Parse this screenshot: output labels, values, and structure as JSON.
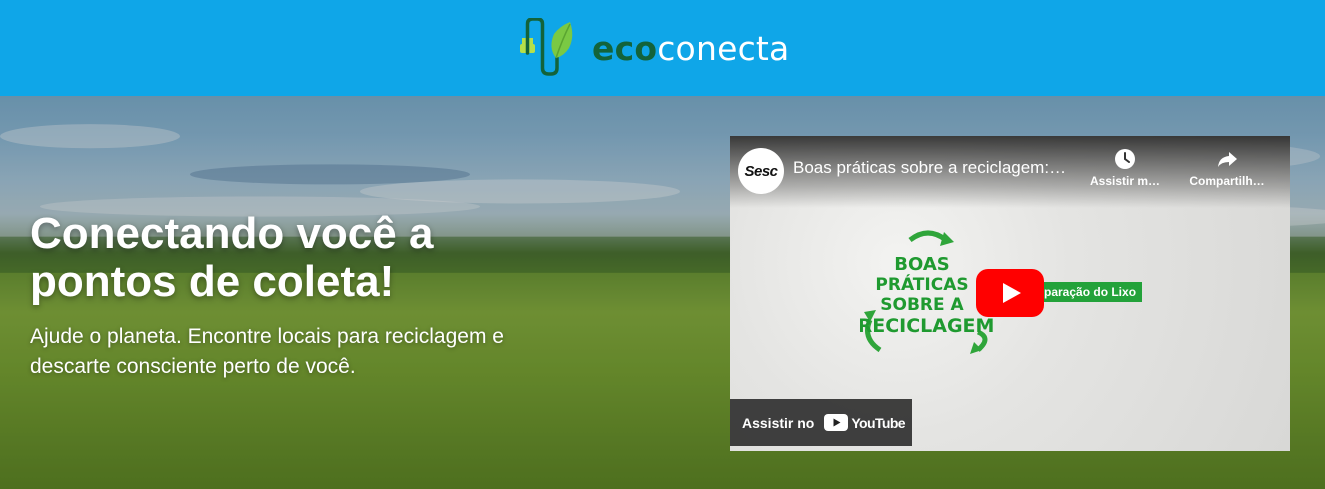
{
  "header": {
    "logo": {
      "part1": "eco",
      "part2": "conecta",
      "icon": "plug-leaf-icon"
    }
  },
  "hero": {
    "title": "Conectando você a pontos de coleta!",
    "subtitle": "Ajude o planeta. Encontre locais para reciclagem e descarte consciente perto de você."
  },
  "video": {
    "channel": "Sesc",
    "title": "Boas práticas sobre a reciclagem:…",
    "watch_later": "Assistir m…",
    "share": "Compartilh…",
    "artwork_lines": [
      "BOAS",
      "PRÁTICAS",
      "SOBRE A",
      "RECICLAGEM"
    ],
    "tag": "paração do Lixo",
    "watch_on": "Assistir no",
    "youtube": "YouTube"
  },
  "colors": {
    "header_bg": "#0fa6e8",
    "logo_eco": "#13633a",
    "play_red": "#ff0000",
    "tag_green": "#23a23a"
  }
}
